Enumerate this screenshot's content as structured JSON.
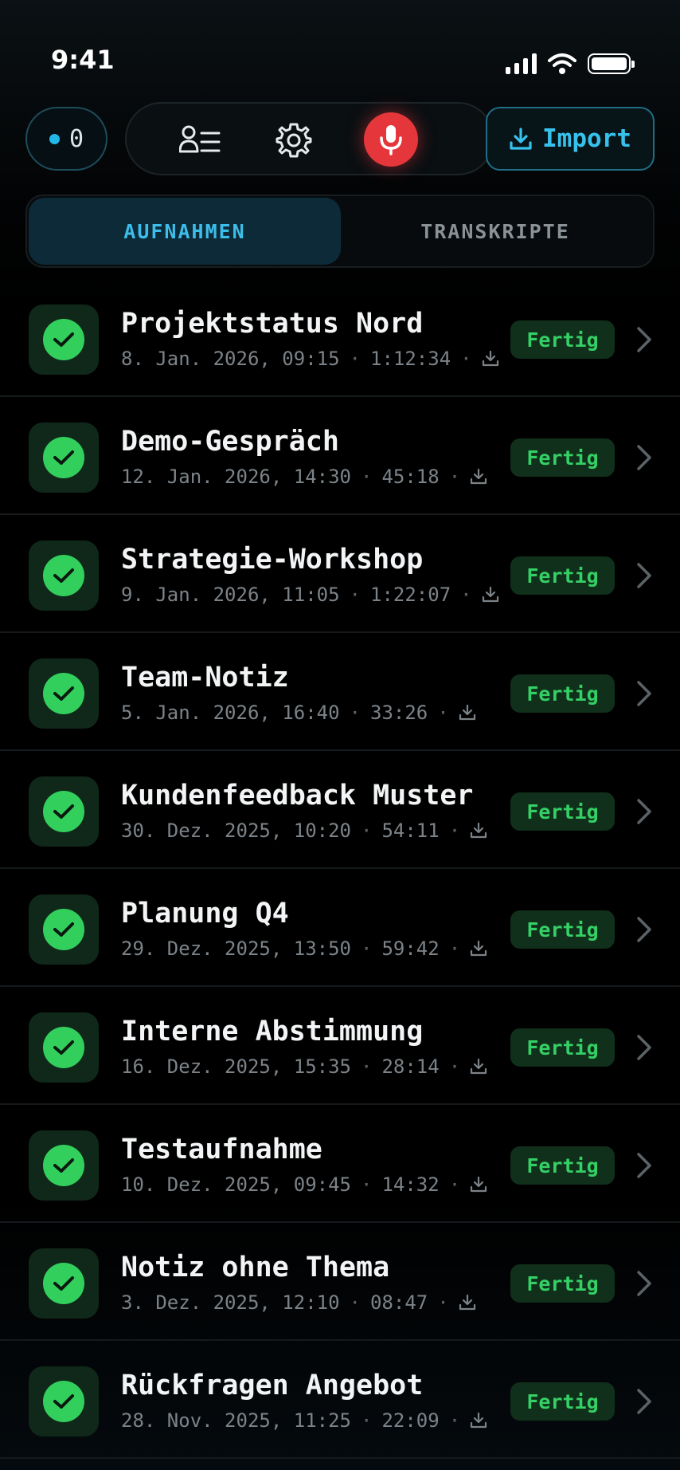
{
  "status_bar": {
    "time": "9:41"
  },
  "toolbar": {
    "counter_value": "0",
    "import_label": "Import",
    "icons": {
      "list": "user-list-icon",
      "settings": "gear-icon",
      "record": "microphone-icon",
      "import": "download-icon"
    },
    "colors": {
      "accent": "#37c2ee",
      "record": "#e5373b"
    }
  },
  "tabs": [
    {
      "label": "AUFNAHMEN",
      "active": true
    },
    {
      "label": "TRANSKRIPTE",
      "active": false
    }
  ],
  "recordings": [
    {
      "title": "Projektstatus Nord",
      "date": "8. Jan. 2026, 09:15",
      "duration": "1:12:34",
      "status": "Fertig"
    },
    {
      "title": "Demo-Gespräch",
      "date": "12. Jan. 2026, 14:30",
      "duration": "45:18",
      "status": "Fertig"
    },
    {
      "title": "Strategie-Workshop",
      "date": "9. Jan. 2026, 11:05",
      "duration": "1:22:07",
      "status": "Fertig"
    },
    {
      "title": "Team-Notiz",
      "date": "5. Jan. 2026, 16:40",
      "duration": "33:26",
      "status": "Fertig"
    },
    {
      "title": "Kundenfeedback Muster",
      "date": "30. Dez. 2025, 10:20",
      "duration": "54:11",
      "status": "Fertig"
    },
    {
      "title": "Planung Q4",
      "date": "29. Dez. 2025, 13:50",
      "duration": "59:42",
      "status": "Fertig"
    },
    {
      "title": "Interne Abstimmung",
      "date": "16. Dez. 2025, 15:35",
      "duration": "28:14",
      "status": "Fertig"
    },
    {
      "title": "Testaufnahme",
      "date": "10. Dez. 2025, 09:45",
      "duration": "14:32",
      "status": "Fertig"
    },
    {
      "title": "Notiz ohne Thema",
      "date": "3. Dez. 2025, 12:10",
      "duration": "08:47",
      "status": "Fertig"
    },
    {
      "title": "Rückfragen Angebot",
      "date": "28. Nov. 2025, 11:25",
      "duration": "22:09",
      "status": "Fertig"
    }
  ],
  "colors": {
    "status_done": "#35d065",
    "check_circle": "#33cf5c"
  }
}
